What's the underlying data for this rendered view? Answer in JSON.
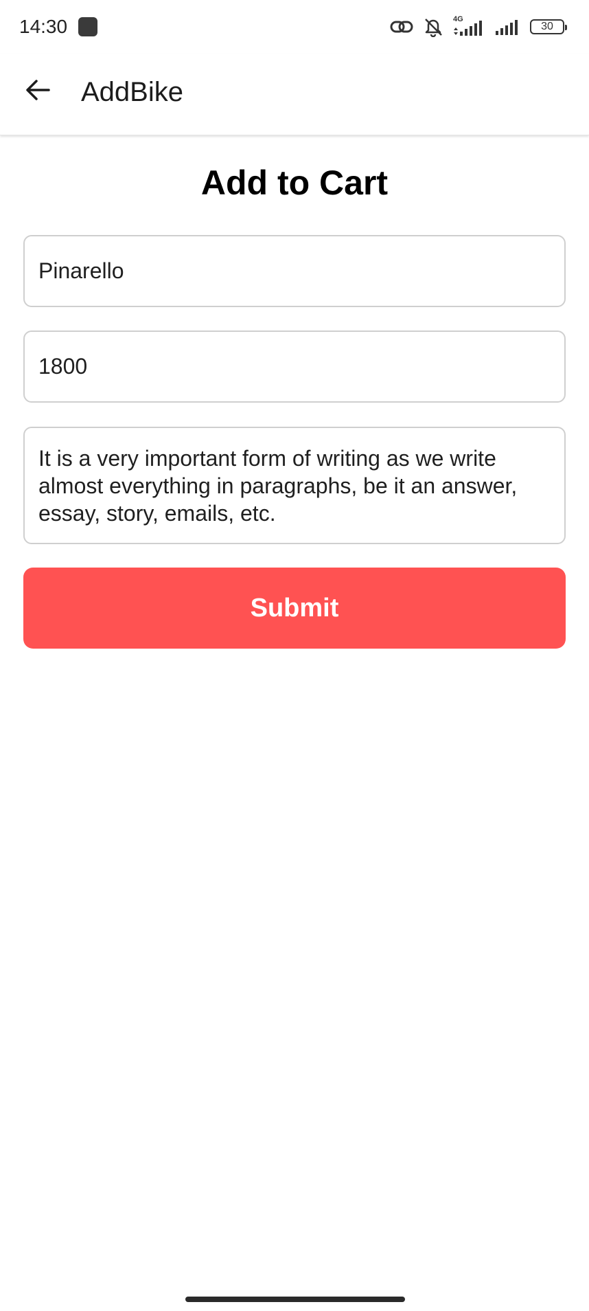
{
  "status_bar": {
    "time": "14:30",
    "network_type": "4G",
    "battery_level": "30",
    "icons": [
      "link-icon",
      "bell-off-icon",
      "signal-4g-icon",
      "signal-icon",
      "battery-icon"
    ]
  },
  "app_bar": {
    "title": "AddBike",
    "back_icon": "arrow-left-icon"
  },
  "form": {
    "heading": "Add to Cart",
    "name_value": "Pinarello",
    "price_value": "1800",
    "description_value": "It is a very important form of writing as we write almost everything in paragraphs, be it an answer, essay, story, emails, etc.",
    "submit_label": "Submit"
  },
  "colors": {
    "accent": "#ff5252",
    "border": "#cfcfcf",
    "text": "#1f1f1f"
  }
}
